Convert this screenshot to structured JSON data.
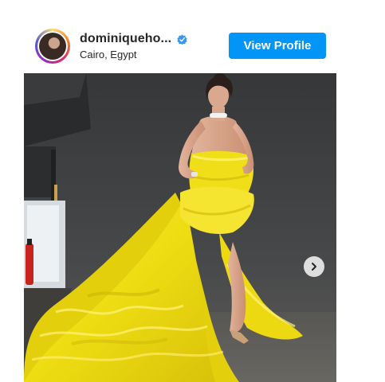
{
  "post": {
    "username": "dominiqueho...",
    "verified": true,
    "location": "Cairo, Egypt",
    "view_profile_label": "View Profile"
  },
  "colors": {
    "button_blue": "#0095f6",
    "verified_blue": "#3897f0",
    "text_dark": "#262626",
    "dress_yellow": "#f2e21a"
  },
  "icons": {
    "verified": "verified-badge-icon",
    "next": "chevron-right-icon"
  }
}
